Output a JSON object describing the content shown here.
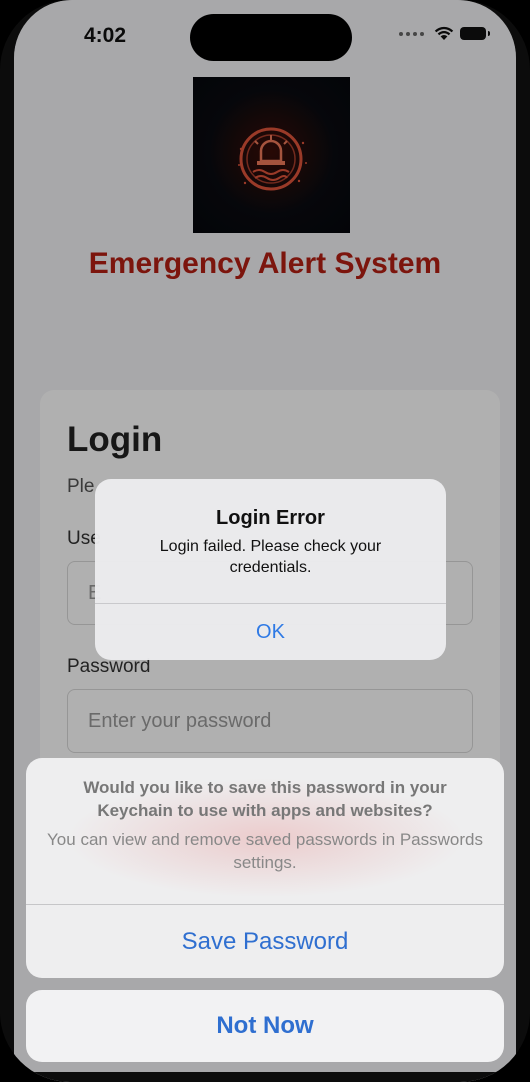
{
  "status_bar": {
    "time": "4:02"
  },
  "app": {
    "title": "Emergency Alert System"
  },
  "login_card": {
    "heading": "Login",
    "subtitle": "Ple",
    "username_label": "Use",
    "username_placeholder": "E",
    "password_label": "Password",
    "password_placeholder": "Enter your password"
  },
  "alert": {
    "title": "Login Error",
    "message": "Login failed. Please check your credentials.",
    "ok_label": "OK"
  },
  "keychain_sheet": {
    "title": "Would you like to save this password in your Keychain to use with apps and websites?",
    "message": "You can view and remove saved passwords in Passwords settings.",
    "save_label": "Save Password",
    "cancel_label": "Not Now"
  },
  "icons": {
    "logo": "alarm-siren-icon",
    "wifi": "wifi-icon",
    "battery": "battery-icon"
  },
  "colors": {
    "brand_title": "#b41f14",
    "ios_blue": "#2f7ae5",
    "logo_accent": "#e0543b"
  }
}
